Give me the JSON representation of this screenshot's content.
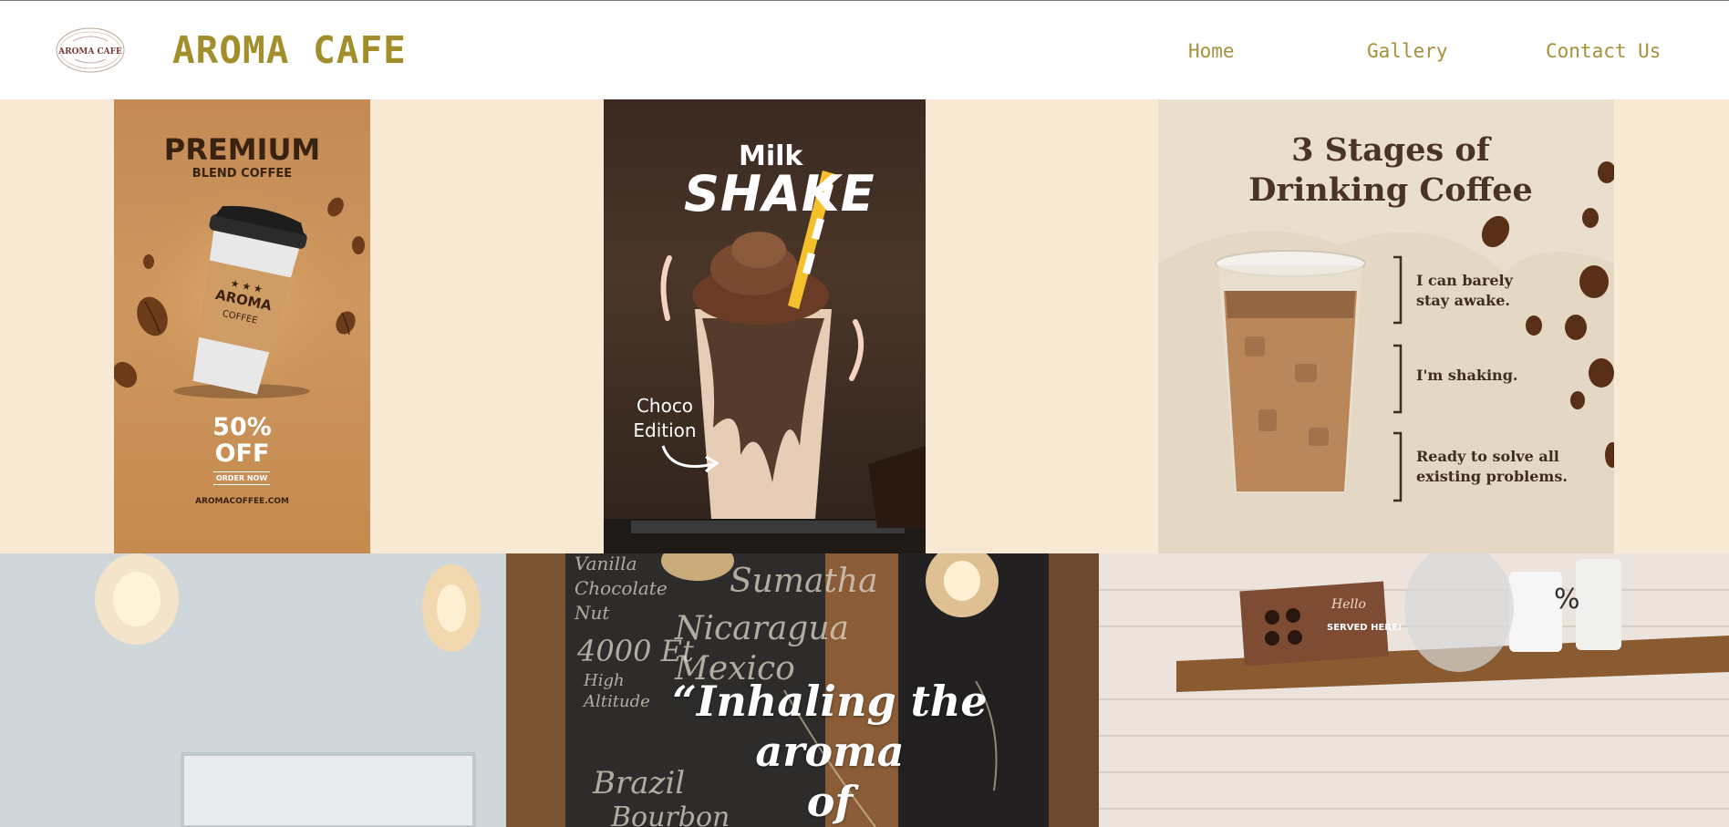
{
  "header": {
    "logo_text": "AROMA CAFE",
    "brand": "AROMA CAFE",
    "nav": [
      "Home",
      "Gallery",
      "Contact Us"
    ]
  },
  "gallery": {
    "card1": {
      "title": "PREMIUM",
      "subtitle": "BLEND COFFEE",
      "cup_brand": "AROMA",
      "cup_sub": "COFFEE",
      "discount_line1": "50%",
      "discount_line2": "OFF",
      "order": "ORDER NOW",
      "url": "AROMACOFFEE.COM"
    },
    "card2": {
      "title_small": "Milk",
      "title_big": "SHAKE",
      "edition_line1": "Choco",
      "edition_line2": "Edition"
    },
    "card3": {
      "title_line1": "3 Stages of",
      "title_line2": "Drinking Coffee",
      "stages": [
        "I can barely stay awake.",
        "I'm shaking.",
        "Ready to solve all existing problems."
      ]
    }
  },
  "hero": {
    "quote_line1": "“Inhaling the aroma",
    "quote_line2": "of",
    "chalkboard": [
      "Vanilla",
      "Chocolate",
      "Nut",
      "4000 Et",
      "High",
      "Altitude",
      "Sumatha",
      "Nicaragua",
      "Mexico",
      "Brazil",
      "Bourbon"
    ],
    "sign": [
      "Hello",
      "SERVED HERE!"
    ]
  },
  "colors": {
    "brand": "#a28f2c",
    "nav": "#a4913a",
    "band": "#f8e9d4"
  }
}
